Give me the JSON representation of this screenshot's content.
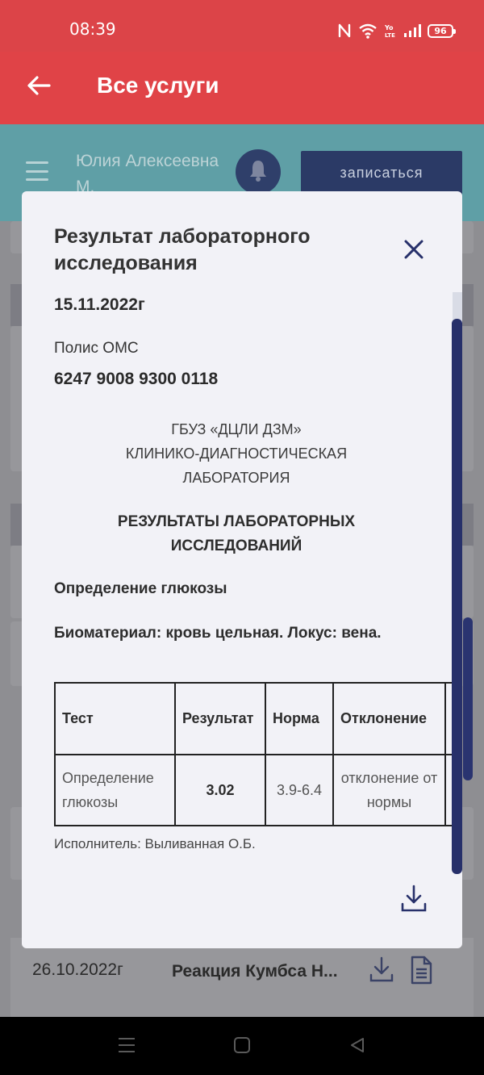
{
  "status_bar": {
    "time": "08:39",
    "battery": "96",
    "icons": [
      "nfc-icon",
      "wifi-icon",
      "volte-icon",
      "signal-icon",
      "battery-icon"
    ]
  },
  "app_bar": {
    "back_icon": "arrow-left-icon",
    "title": "Все услуги"
  },
  "sub_header": {
    "menu_icon": "hamburger-icon",
    "user_name": "Юлия Алексеевна М.",
    "bell_icon": "bell-icon",
    "book_button": "записаться"
  },
  "background_row": {
    "date": "26.10.2022г",
    "name": "Реакция Кумбса Н...",
    "icons": [
      "download-icon",
      "document-icon"
    ]
  },
  "modal": {
    "title": "Результат лабораторного исследования",
    "date": "15.11.2022г",
    "policy_label": "Полис ОМС",
    "policy_number": "6247 9008 9300 0118",
    "lab_org_lines": [
      "ГБУЗ «ДЦЛИ ДЗМ»",
      "КЛИНИКО-ДИАГНОСТИЧЕСКАЯ",
      "ЛАБОРАТОРИЯ"
    ],
    "results_heading_lines": [
      "РЕЗУЛЬТАТЫ ЛАБОРАТОРНЫХ",
      "ИССЛЕДОВАНИЙ"
    ],
    "test_name": "Определение глюкозы",
    "biomaterial": "Биоматериал: кровь цельная. Локус: вена.",
    "table": {
      "headers": [
        "Тест",
        "Результат",
        "Норма",
        "Отклонение"
      ],
      "rows": [
        [
          "Определение глюкозы",
          "3.02",
          "3.9-6.4",
          "отклонение от нормы"
        ]
      ]
    },
    "executor": "Исполнитель: Выливанная О.Б.",
    "close_icon": "close-icon",
    "download_icon": "download-icon"
  },
  "nav_bar": {
    "icons": [
      "recents-icon",
      "home-icon",
      "back-icon"
    ]
  },
  "colors": {
    "status_bar": "#dc4448",
    "app_bar": "#e04347",
    "accent_navy": "#2b3a66",
    "modal_bg": "#f2f2f7"
  }
}
